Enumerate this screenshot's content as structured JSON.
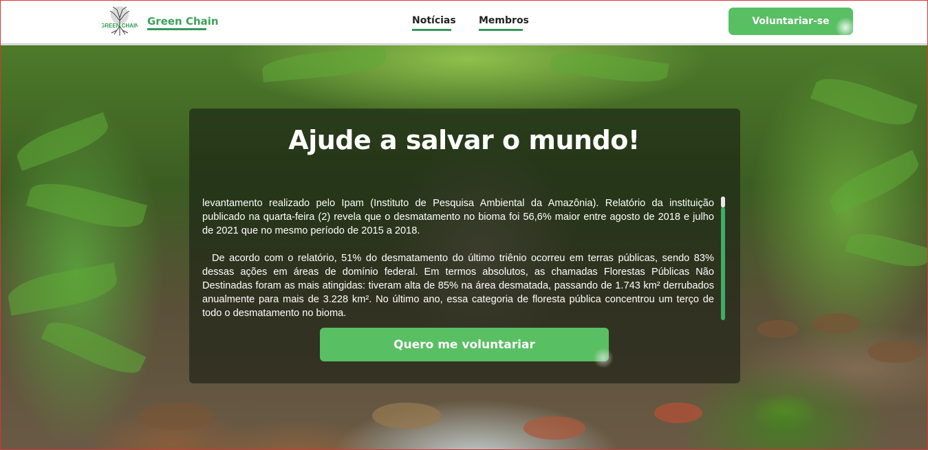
{
  "header": {
    "brand": "Green Chain",
    "logo_text": "GREEN CHAIN",
    "nav": [
      {
        "label": "Notícias"
      },
      {
        "label": "Membros"
      }
    ],
    "volunteer_label": "Voluntariar-se"
  },
  "hero": {
    "title": "Ajude a salvar o mundo!",
    "paragraphs": [
      "levantamento realizado pelo Ipam (Instituto de Pesquisa Ambiental da Amazônia). Relatório da instituição publicado na quarta-feira (2) revela que o desmatamento no bioma foi 56,6% maior entre agosto de 2018 e julho de 2021 que no mesmo período de 2015 a 2018.",
      "De acordo com o relatório, 51% do desmatamento do último triênio ocorreu em terras públicas, sendo 83% dessas ações em áreas de domínio federal. Em termos absolutos, as chamadas Florestas Públicas Não Destinadas foram as mais atingidas: tiveram alta de 85% na área desmatada, passando de 1.743 km² derrubados anualmente para mais de 3.228 km². No último ano, essa categoria de floresta pública concentrou um terço de todo o desmatamento no bioma."
    ],
    "cta_label": "Quero me voluntariar"
  },
  "colors": {
    "accent": "#58bf63",
    "brand_text": "#3aa35a",
    "underline": "#2f9a55"
  }
}
